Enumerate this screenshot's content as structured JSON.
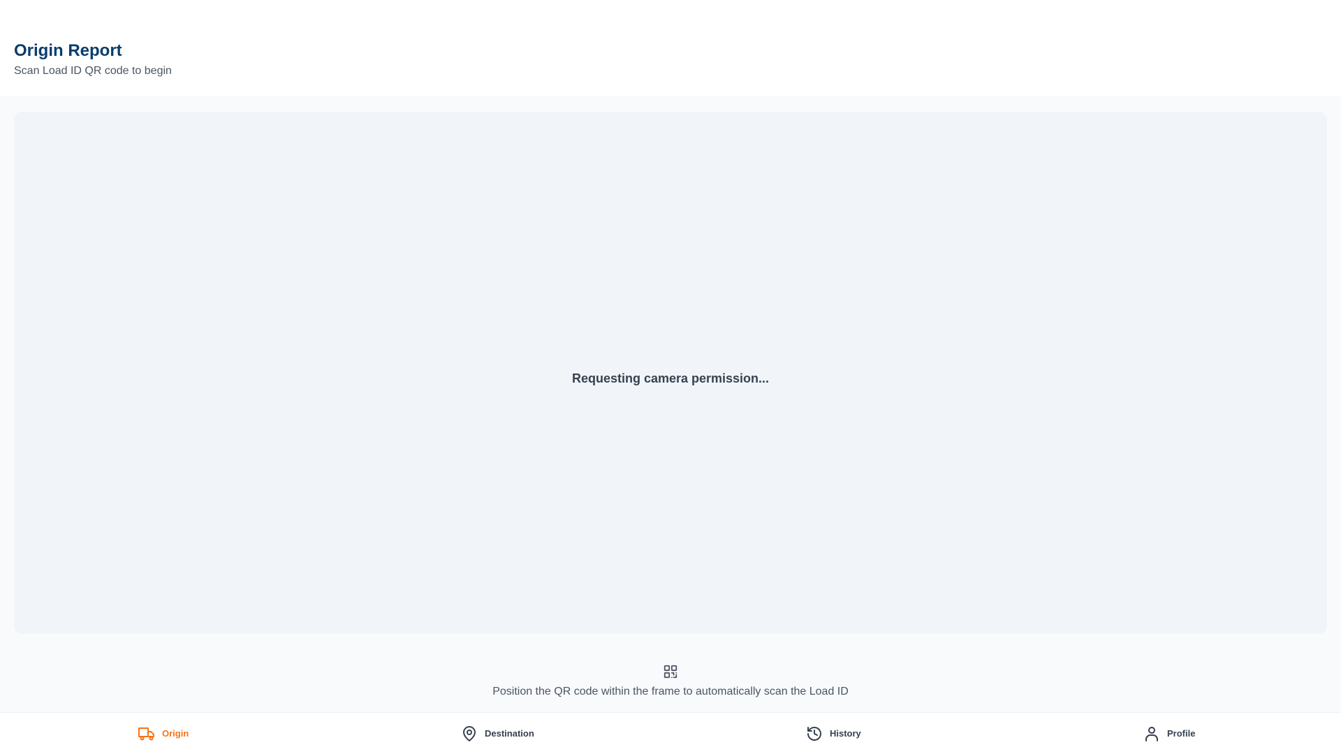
{
  "header": {
    "title": "Origin Report",
    "subtitle": "Scan Load ID QR code to begin"
  },
  "scanner": {
    "status_text": "Requesting camera permission...",
    "hint_icon": "qr-code-icon",
    "hint_text": "Position the QR code within the frame to automatically scan the Load ID"
  },
  "nav": {
    "accent_color": "#f97316",
    "items": [
      {
        "label": "Origin",
        "icon": "truck-icon",
        "active": true
      },
      {
        "label": "Destination",
        "icon": "map-pin-icon",
        "active": false
      },
      {
        "label": "History",
        "icon": "history-icon",
        "active": false
      },
      {
        "label": "Profile",
        "icon": "user-icon",
        "active": false
      }
    ]
  }
}
